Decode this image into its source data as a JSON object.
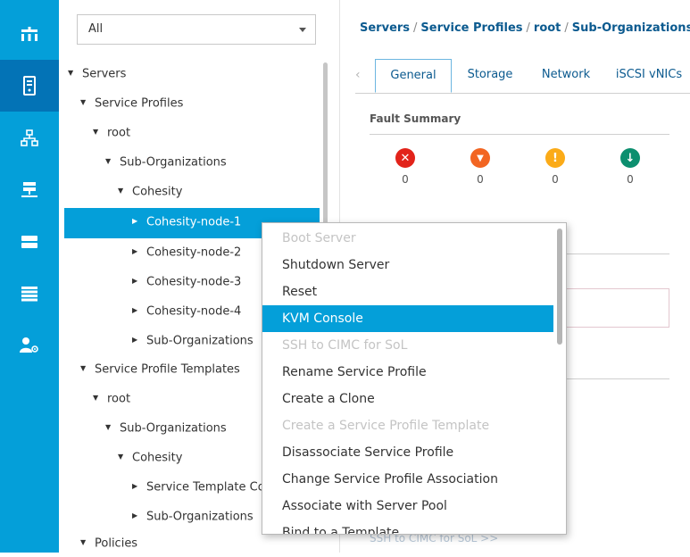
{
  "rail": {
    "items": [
      {
        "icon": "equipment-icon",
        "active": false
      },
      {
        "icon": "servers-icon",
        "active": true
      },
      {
        "icon": "lan-icon",
        "active": false
      },
      {
        "icon": "san-icon",
        "active": false
      },
      {
        "icon": "storage-icon",
        "active": false
      },
      {
        "icon": "chassis-icon",
        "active": false
      },
      {
        "icon": "admin-icon",
        "active": false
      }
    ]
  },
  "tree": {
    "filter_value": "All",
    "rows": [
      {
        "label": "Servers",
        "expanded": true
      },
      {
        "label": "Service Profiles",
        "expanded": true
      },
      {
        "label": "root",
        "expanded": true
      },
      {
        "label": "Sub-Organizations",
        "expanded": true
      },
      {
        "label": "Cohesity",
        "expanded": true
      },
      {
        "label": "Cohesity-node-1",
        "expanded": false,
        "selected": true
      },
      {
        "label": "Cohesity-node-2",
        "expanded": false
      },
      {
        "label": "Cohesity-node-3",
        "expanded": false
      },
      {
        "label": "Cohesity-node-4",
        "expanded": false
      },
      {
        "label": "Sub-Organizations",
        "expanded": false
      },
      {
        "label": "Service Profile Templates",
        "expanded": true
      },
      {
        "label": "root",
        "expanded": true
      },
      {
        "label": "Sub-Organizations",
        "expanded": true
      },
      {
        "label": "Cohesity",
        "expanded": true
      },
      {
        "label": "Service Template Co",
        "expanded": false
      },
      {
        "label": "Sub-Organizations",
        "expanded": false
      },
      {
        "label": "Policies",
        "expanded": true
      }
    ]
  },
  "breadcrumb": [
    "Servers",
    "Service Profiles",
    "root",
    "Sub-Organizations"
  ],
  "breadcrumb_sep": "/",
  "tabs": {
    "prev_glyph": "‹",
    "items": [
      "General",
      "Storage",
      "Network",
      "iSCSI vNICs"
    ],
    "active": "General"
  },
  "fault_summary": {
    "title": "Fault Summary",
    "items": [
      {
        "icon": "critical-icon",
        "color": "#e2231a",
        "glyph": "✕",
        "count": "0"
      },
      {
        "icon": "major-icon",
        "color": "#f26522",
        "glyph": "▼",
        "count": "0"
      },
      {
        "icon": "minor-icon",
        "color": "#fbab18",
        "glyph": "!",
        "count": "0"
      },
      {
        "icon": "warning-icon",
        "color": "#0c8f6f",
        "glyph": "↓",
        "count": "0"
      }
    ]
  },
  "ghost_link": "SSH to CIMC for SoL >>",
  "context_menu": {
    "items": [
      {
        "label": "Boot Server",
        "state": "disabled"
      },
      {
        "label": "Shutdown Server",
        "state": "enabled"
      },
      {
        "label": "Reset",
        "state": "enabled"
      },
      {
        "label": "KVM Console",
        "state": "highlight"
      },
      {
        "label": "SSH to CIMC for SoL",
        "state": "disabled"
      },
      {
        "label": "Rename Service Profile",
        "state": "enabled"
      },
      {
        "label": "Create a Clone",
        "state": "enabled"
      },
      {
        "label": "Create a Service Profile Template",
        "state": "disabled"
      },
      {
        "label": "Disassociate Service Profile",
        "state": "enabled"
      },
      {
        "label": "Change Service Profile Association",
        "state": "enabled"
      },
      {
        "label": "Associate with Server Pool",
        "state": "enabled"
      },
      {
        "label": "Bind to a Template",
        "state": "enabled"
      }
    ]
  },
  "colors": {
    "rail": "#049fd9",
    "rail_active": "#0373b6",
    "selection": "#049fd9",
    "link": "#0b5a8f"
  }
}
